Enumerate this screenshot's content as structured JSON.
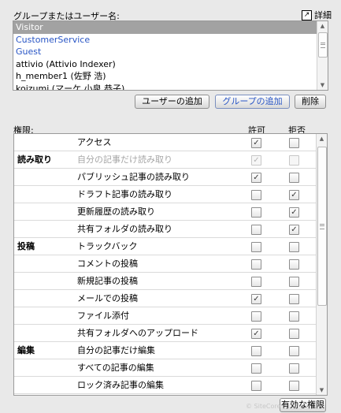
{
  "header": {
    "label": "グループまたはユーザー名:",
    "detail_label": "詳細",
    "detail_icon": "↗"
  },
  "principals": [
    {
      "name": "Visitor",
      "selected": true,
      "type": "user"
    },
    {
      "name": "CustomerService",
      "selected": false,
      "type": "group"
    },
    {
      "name": "Guest",
      "selected": false,
      "type": "group"
    },
    {
      "name": "attivio (Attivio Indexer)",
      "selected": false,
      "type": "user"
    },
    {
      "name": "h_member1 (佐野 浩)",
      "selected": false,
      "type": "user"
    },
    {
      "name": "koizumi (マーケ 小泉 恭子)",
      "selected": false,
      "type": "user"
    }
  ],
  "buttons": {
    "add_user": "ユーザーの追加",
    "add_group": "グループの追加",
    "delete": "削除",
    "effective": "有効な権限"
  },
  "permissions_header": {
    "label": "権限:",
    "allow": "許可",
    "deny": "拒否"
  },
  "permissions": [
    {
      "category": "",
      "name": "アクセス",
      "allow": true,
      "deny": false,
      "disabled": false
    },
    {
      "category": "読み取り",
      "name": "自分の記事だけ読み取り",
      "allow": true,
      "deny": false,
      "disabled": true
    },
    {
      "category": "",
      "name": "パブリッシュ記事の読み取り",
      "allow": true,
      "deny": false,
      "disabled": false
    },
    {
      "category": "",
      "name": "ドラフト記事の読み取り",
      "allow": false,
      "deny": true,
      "disabled": false
    },
    {
      "category": "",
      "name": "更新履歴の読み取り",
      "allow": false,
      "deny": true,
      "disabled": false
    },
    {
      "category": "",
      "name": "共有フォルダの読み取り",
      "allow": false,
      "deny": true,
      "disabled": false
    },
    {
      "category": "投稿",
      "name": "トラックバック",
      "allow": false,
      "deny": false,
      "disabled": false
    },
    {
      "category": "",
      "name": "コメントの投稿",
      "allow": false,
      "deny": false,
      "disabled": false
    },
    {
      "category": "",
      "name": "新規記事の投稿",
      "allow": false,
      "deny": false,
      "disabled": false
    },
    {
      "category": "",
      "name": "メールでの投稿",
      "allow": true,
      "deny": false,
      "disabled": false
    },
    {
      "category": "",
      "name": "ファイル添付",
      "allow": false,
      "deny": false,
      "disabled": false
    },
    {
      "category": "",
      "name": "共有フォルダへのアップロード",
      "allow": true,
      "deny": false,
      "disabled": false
    },
    {
      "category": "編集",
      "name": "自分の記事だけ編集",
      "allow": false,
      "deny": false,
      "disabled": false
    },
    {
      "category": "",
      "name": "すべての記事の編集",
      "allow": false,
      "deny": false,
      "disabled": false
    },
    {
      "category": "",
      "name": "ロック済み記事の編集",
      "allow": false,
      "deny": false,
      "disabled": false
    }
  ],
  "watermark": "© SiteCore"
}
